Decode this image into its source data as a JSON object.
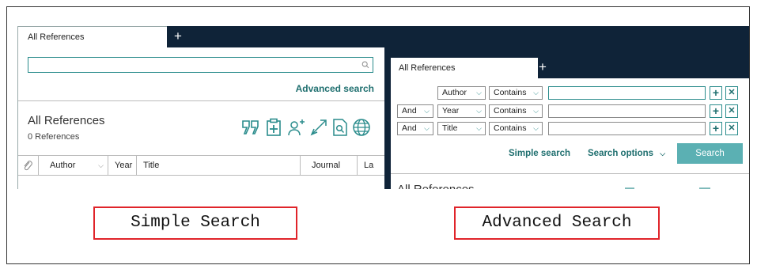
{
  "simple_search": {
    "tab_label": "All References",
    "add_tab": "+",
    "search_value": "",
    "advanced_link": "Advanced search",
    "library_title": "All References",
    "reference_count": "0 References",
    "toolbar_icons": [
      "quote-icon",
      "clipboard-add-icon",
      "add-user-icon",
      "share-icon",
      "find-pdf-icon",
      "globe-icon"
    ],
    "columns": [
      "Author",
      "Year",
      "Title",
      "Journal",
      "La"
    ],
    "attachment_icon": "paperclip-icon"
  },
  "advanced_search": {
    "tab_label": "All References",
    "add_tab": "+",
    "rows": [
      {
        "connector": "",
        "field": "Author",
        "operator": "Contains",
        "value": ""
      },
      {
        "connector": "And",
        "field": "Year",
        "operator": "Contains",
        "value": ""
      },
      {
        "connector": "And",
        "field": "Title",
        "operator": "Contains",
        "value": ""
      }
    ],
    "add_symbol": "+",
    "remove_symbol": "✕",
    "simple_link": "Simple search",
    "options_link": "Search options",
    "search_button": "Search",
    "library_title": "All References"
  },
  "captions": {
    "simple": "Simple Search",
    "advanced": "Advanced Search"
  },
  "colors": {
    "accent": "#2a8c8c",
    "nav_dark": "#0f2338",
    "search_button": "#5bb0b3",
    "caption_border": "#e0242a"
  }
}
